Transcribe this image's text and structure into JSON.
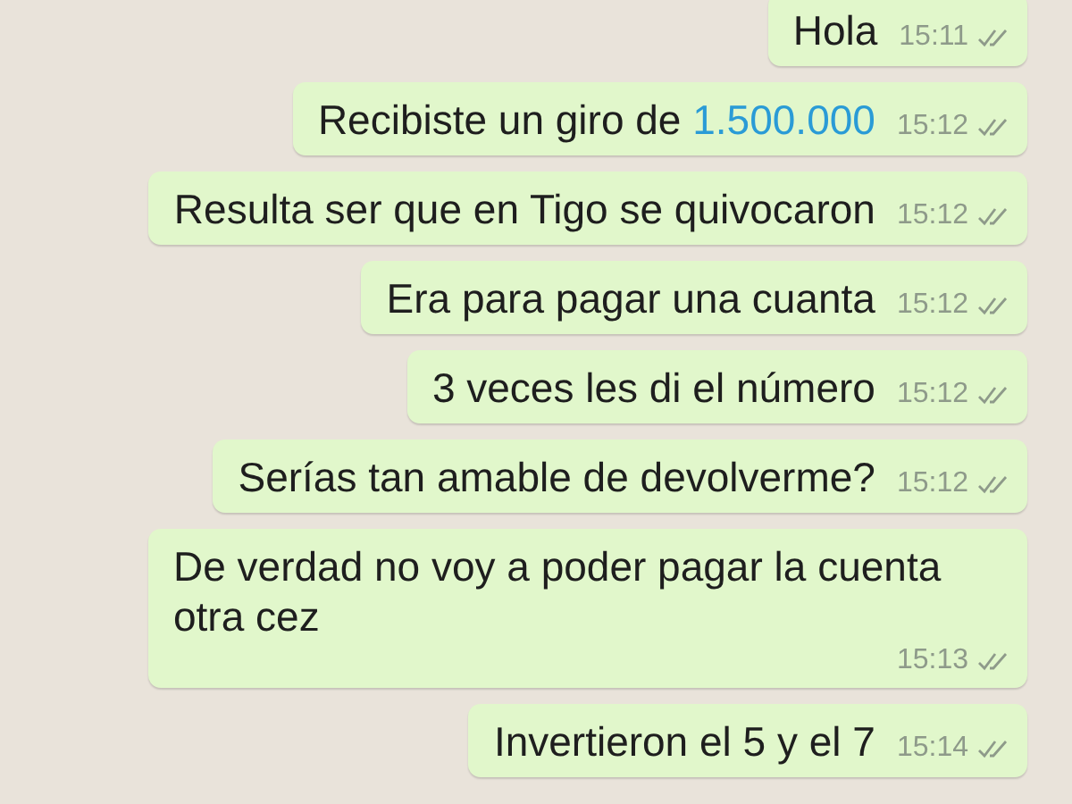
{
  "messages": [
    {
      "text": "Hola",
      "time": "15:11",
      "read": false
    },
    {
      "text": "Recibiste un giro de ",
      "link": "1.500.000",
      "time": "15:12",
      "read": false
    },
    {
      "text": "Resulta ser que en Tigo se quivocaron",
      "time": "15:12",
      "read": false
    },
    {
      "text": "Era para pagar una cuanta",
      "time": "15:12",
      "read": false
    },
    {
      "text": "3 veces les di el número",
      "time": "15:12",
      "read": false
    },
    {
      "text": "Serías tan amable de devolverme?",
      "time": "15:12",
      "read": false
    },
    {
      "text": "De verdad no voy a poder pagar la cuenta otra cez",
      "time": "15:13",
      "read": false
    },
    {
      "text": "Invertieron el 5 y el 7",
      "time": "15:14",
      "read": false
    }
  ]
}
